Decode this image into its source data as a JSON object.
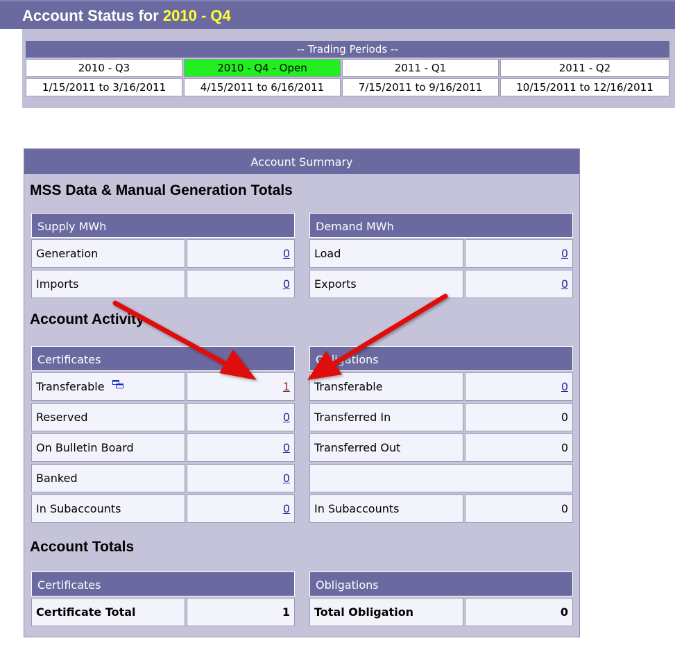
{
  "header": {
    "title_prefix": "Account Status for",
    "period": "2010 - Q4"
  },
  "trading_periods": {
    "heading": "-- Trading Periods --",
    "periods": [
      {
        "name": "2010 - Q3",
        "range": "1/15/2011 to 3/16/2011"
      },
      {
        "name": "2010 - Q4 - Open",
        "range": "4/15/2011 to 6/16/2011"
      },
      {
        "name": "2011 - Q1",
        "range": "7/15/2011 to 9/16/2011"
      },
      {
        "name": "2011 - Q2",
        "range": "10/15/2011 to 12/16/2011"
      }
    ]
  },
  "summary": {
    "heading": "Account Summary",
    "mss_title": "MSS Data & Manual Generation Totals",
    "supply": {
      "head": "Supply MWh",
      "rows": [
        {
          "label": "Generation",
          "value": "0"
        },
        {
          "label": "Imports",
          "value": "0"
        }
      ]
    },
    "demand": {
      "head": "Demand MWh",
      "rows": [
        {
          "label": "Load",
          "value": "0"
        },
        {
          "label": "Exports",
          "value": "0"
        }
      ]
    },
    "activity_title": "Account Activity",
    "certificates": {
      "head": "Certificates",
      "rows": [
        {
          "label": "Transferable",
          "value": "1"
        },
        {
          "label": "Reserved",
          "value": "0"
        },
        {
          "label": "On Bulletin Board",
          "value": "0"
        },
        {
          "label": "Banked",
          "value": "0"
        },
        {
          "label": "In Subaccounts",
          "value": "0"
        }
      ]
    },
    "obligations": {
      "head": "Obligations",
      "rows": [
        {
          "label": "Transferable",
          "value": "0"
        },
        {
          "label": "Transferred In",
          "value": "0"
        },
        {
          "label": "Transferred Out",
          "value": "0"
        },
        {
          "label": "In Subaccounts",
          "value": "0"
        }
      ]
    },
    "totals_title": "Account Totals",
    "totals_certificates": {
      "head": "Certificates",
      "label": "Certificate Total",
      "value": "1"
    },
    "totals_obligations": {
      "head": "Obligations",
      "label": "Total Obligation",
      "value": "0"
    }
  },
  "icons": {
    "split_window": "split-window-icon",
    "annotation_arrow": "red-arrow-icon"
  },
  "colors": {
    "header_bar": "#6a6aa0",
    "panel_bg": "#c4c3d9",
    "open_period": "#22ee22",
    "title_highlight": "#ffff33",
    "arrow": "#e01010"
  }
}
